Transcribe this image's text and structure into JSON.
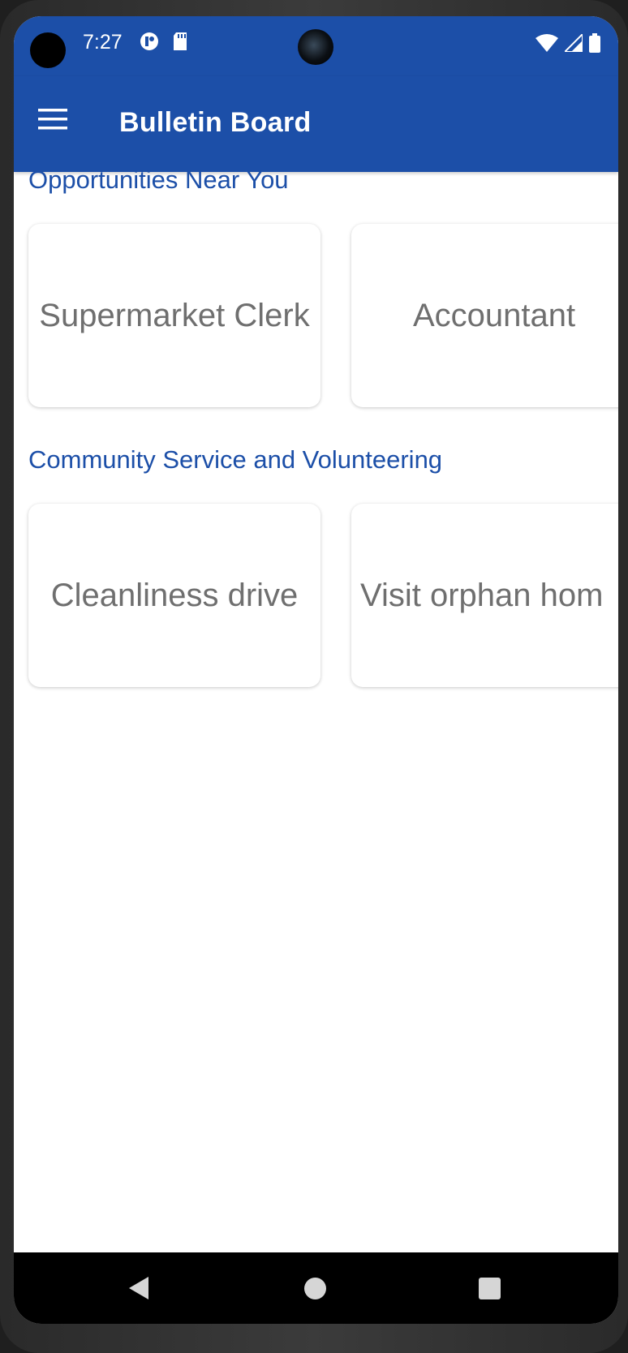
{
  "status_bar": {
    "time": "7:27",
    "left_icons": [
      "notification-app-icon",
      "sd-card-icon"
    ],
    "right_icons": [
      "wifi-icon",
      "signal-icon",
      "battery-icon"
    ]
  },
  "app_bar": {
    "title": "Bulletin Board",
    "menu_icon": "hamburger-menu-icon",
    "color": "#1c4fa8"
  },
  "sections": [
    {
      "title": "Opportunities Near You",
      "cards": [
        {
          "label": "Supermarket Clerk"
        },
        {
          "label": "Accountant"
        }
      ]
    },
    {
      "title": "Community Service and Volunteering",
      "cards": [
        {
          "label": "Cleanliness drive"
        },
        {
          "label": "Visit orphan hom"
        }
      ]
    }
  ],
  "nav_bar": {
    "buttons": [
      "back-icon",
      "home-icon",
      "recent-apps-icon"
    ]
  }
}
